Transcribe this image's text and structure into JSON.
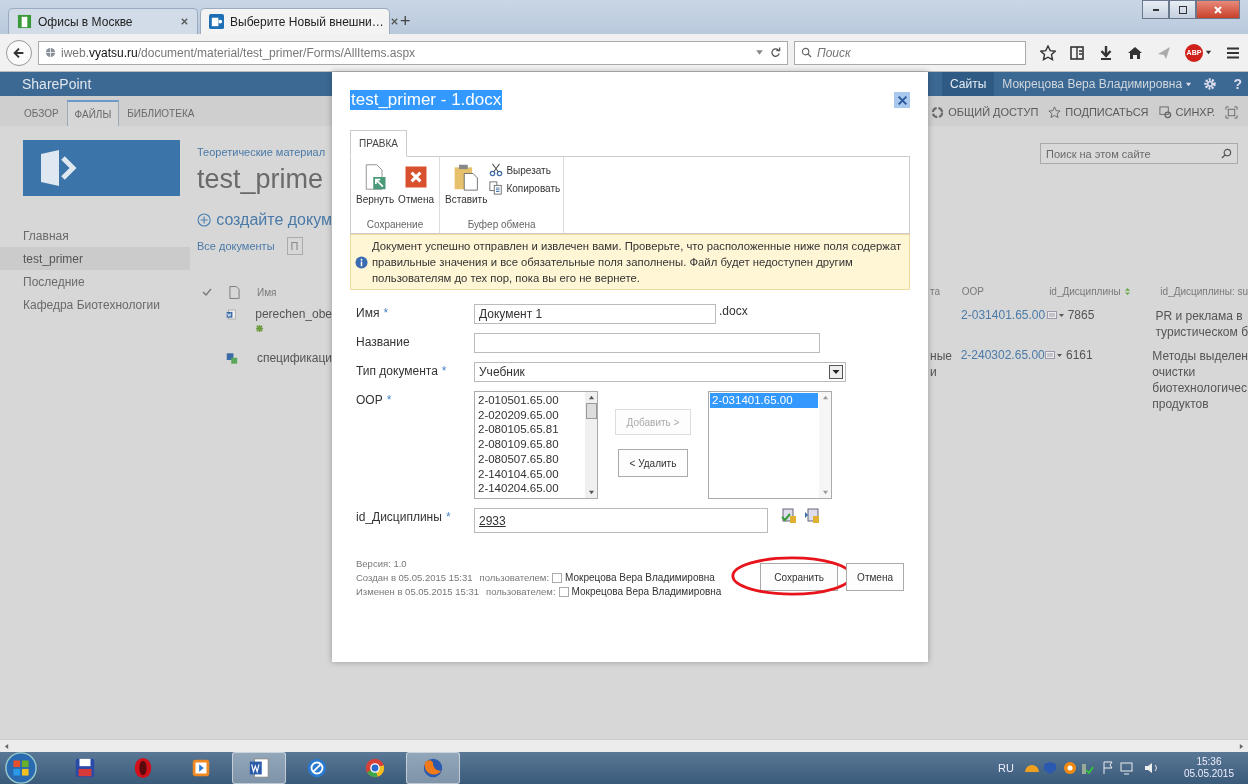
{
  "browser": {
    "tabs": [
      {
        "title": "Офисы в Москве",
        "kind": "office",
        "selected": false
      },
      {
        "title": "Выберите Новый внешни…",
        "kind": "sharepoint",
        "selected": true
      }
    ],
    "new_tab": "+",
    "url": "iweb.**vyatsu.ru**/document/material/test_primer/Forms/AllItems.aspx",
    "search": {
      "placeholder": "Поиск"
    },
    "abp": "ABP"
  },
  "suite": {
    "brand": "SharePoint",
    "sites": "Сайты",
    "user": "Мокрецова Вера Владимировна",
    "help": "?"
  },
  "ribbon": {
    "tabs": [
      {
        "label": "ОБЗОР",
        "selected": false
      },
      {
        "label": "ФАЙЛЫ",
        "selected": true
      },
      {
        "label": "БИБЛИОТЕКА",
        "selected": false
      }
    ],
    "actions": [
      {
        "label": "ОБЩИЙ ДОСТУП",
        "kind": "share"
      },
      {
        "label": "ПОДПИСАТЬСЯ",
        "kind": "follow"
      },
      {
        "label": "СИНХР.",
        "kind": "sync"
      }
    ]
  },
  "nav": [
    {
      "label": "Главная",
      "selected": false
    },
    {
      "label": "test_primer",
      "selected": true
    },
    {
      "label": "Последние",
      "selected": false
    },
    {
      "label": "Кафедра Биотехнологии",
      "selected": false
    }
  ],
  "library": {
    "breadcrumb": "Теоретические материал",
    "title": "test_prime",
    "new_document": "создайте докум",
    "view": "Все документы",
    "find": "П",
    "name_column": "Имя",
    "columns": [
      "та",
      "OOP",
      "id_Дисциплины",
      "id_Дисциплины: su"
    ],
    "rows": [
      {
        "name": "perechen_obe",
        "kind": "word",
        "new": true,
        "oop": "2-031401.65.00",
        "id": "7865",
        "subject": "PR и реклама в\nтуристическом б"
      },
      {
        "name": "спецификаци",
        "kind": "word-linked",
        "new": false,
        "fragment": "ные\nи",
        "oop": "2-240302.65.00",
        "id": "6161",
        "subject": "Методы выделен\nочистки\nбиотехнологичес\nпродуктов"
      }
    ]
  },
  "site_search": {
    "placeholder": "Поиск на этом сайте"
  },
  "dialog": {
    "title": "test_primer - 1.docx",
    "ribbon_tab": "ПРАВКА",
    "groups": [
      {
        "label": "Сохранение",
        "buttons": [
          {
            "label": "Вернуть",
            "kind": "checkin"
          },
          {
            "label": "Отмена",
            "kind": "cancel"
          }
        ]
      },
      {
        "label": "Буфер обмена",
        "buttons": [
          {
            "label": "Вставить",
            "kind": "paste"
          },
          {
            "label": "Вырезать",
            "kind": "cut"
          },
          {
            "label": "Копировать",
            "kind": "copy"
          }
        ]
      }
    ],
    "notice": "Документ успешно отправлен и извлечен вами. Проверьте, что расположенные ниже поля содержат правильные значения и все обязательные поля заполнены. Файл будет недоступен другим пользователям до тех пор, пока вы его не вернете.",
    "fields": [
      {
        "label": "Имя",
        "mark": "*",
        "kind": "text",
        "value": "Документ 1",
        "suffix": ".docx"
      },
      {
        "label": "Название",
        "kind": "text"
      },
      {
        "label": "Тип документа",
        "mark": "*",
        "kind": "select",
        "value": "Учебник"
      },
      {
        "label": "OOP",
        "mark": "*",
        "kind": "multi",
        "options": [
          {
            "label": "2-010501.65.00",
            "selected": false
          },
          {
            "label": "2-020209.65.00",
            "selected": false
          },
          {
            "label": "2-080105.65.81",
            "selected": false
          },
          {
            "label": "2-080109.65.80",
            "selected": false
          },
          {
            "label": "2-080507.65.80",
            "selected": false
          },
          {
            "label": "2-140104.65.00",
            "selected": false
          },
          {
            "label": "2-140204.65.00",
            "selected": false
          }
        ],
        "chosen": [
          {
            "label": "2-031401.65.00",
            "selected": true
          }
        ],
        "add": {
          "label": "Добавить >",
          "disabled": true
        },
        "remove": {
          "label": "< Удалить",
          "disabled": false
        }
      },
      {
        "label": "id_Дисциплины",
        "mark": "*",
        "kind": "lookup",
        "value": "2933"
      }
    ],
    "version": "Версия: 1.0",
    "created": {
      "text": "Создан в 05.05.2015 15:31",
      "by": "пользователем:",
      "user": "Мокрецова Вера Владимировна"
    },
    "modified": {
      "text": "Изменен в 05.05.2015 15:31",
      "by": "пользователем:",
      "user": "Мокрецова Вера Владимировна"
    },
    "buttons": [
      {
        "label": "Сохранить",
        "circled": true
      },
      {
        "label": "Отмена",
        "circled": false
      }
    ]
  },
  "taskbar": {
    "apps": [
      {
        "kind": "floppy",
        "selected": false
      },
      {
        "kind": "opera",
        "selected": false
      },
      {
        "kind": "player",
        "selected": false
      },
      {
        "kind": "word",
        "selected": true
      },
      {
        "kind": "round",
        "selected": false
      },
      {
        "kind": "chrome",
        "selected": false
      },
      {
        "kind": "firefox",
        "selected": true
      }
    ],
    "lang": "RU",
    "time": "15:36",
    "date": "05.05.2015"
  }
}
